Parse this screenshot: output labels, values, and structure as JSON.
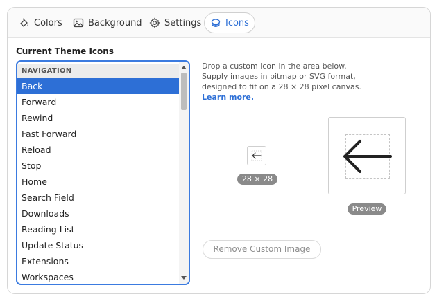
{
  "tabs": [
    {
      "label": "Colors",
      "icon": "paint-bucket-icon"
    },
    {
      "label": "Background",
      "icon": "image-icon"
    },
    {
      "label": "Settings",
      "icon": "gear-icon"
    },
    {
      "label": "Icons",
      "icon": "icons-stack-icon",
      "active": true
    }
  ],
  "section_title": "Current Theme Icons",
  "list": {
    "header": "NAVIGATION",
    "items": [
      "Back",
      "Forward",
      "Rewind",
      "Fast Forward",
      "Reload",
      "Stop",
      "Home",
      "Search Field",
      "Downloads",
      "Reading List",
      "Update Status",
      "Extensions",
      "Workspaces"
    ],
    "selected": "Back"
  },
  "help": {
    "text": "Drop a custom icon in the area below. Supply images in bitmap or SVG format, designed to fit on a 28 × 28 pixel canvas. ",
    "link": "Learn more."
  },
  "small_size_label": "28 × 28",
  "preview_label": "Preview",
  "remove_button": "Remove Custom Image",
  "colors": {
    "accent": "#2d6fd6",
    "selected_row": "#2d6fd6",
    "badge": "#8a8a8a"
  }
}
